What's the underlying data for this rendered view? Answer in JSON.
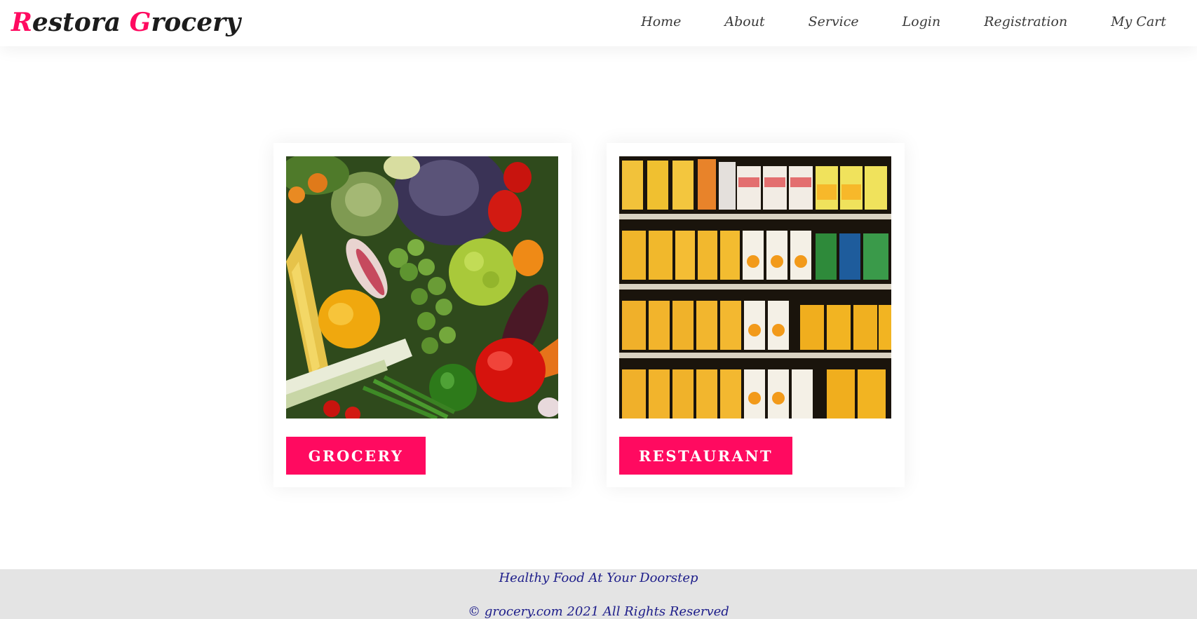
{
  "brand": {
    "first_initial": "R",
    "first_rest": "estora ",
    "second_initial": "G",
    "second_rest": "rocery",
    "accent_color": "#ff0a60"
  },
  "nav": {
    "items": [
      {
        "label": "Home"
      },
      {
        "label": "About"
      },
      {
        "label": "Service"
      },
      {
        "label": "Login"
      },
      {
        "label": "Registration"
      },
      {
        "label": "My Cart"
      }
    ]
  },
  "cards": [
    {
      "button_label": "GROCERY",
      "image": "vegetables-photo"
    },
    {
      "button_label": "RESTAURANT",
      "image": "juice-shelves-photo"
    }
  ],
  "footer": {
    "tagline": "Healthy Food At Your Doorstep",
    "copyright": "© grocery.com 2021 All Rights Reserved",
    "text_color": "#1d1d8a",
    "background": "#e4e4e4"
  }
}
